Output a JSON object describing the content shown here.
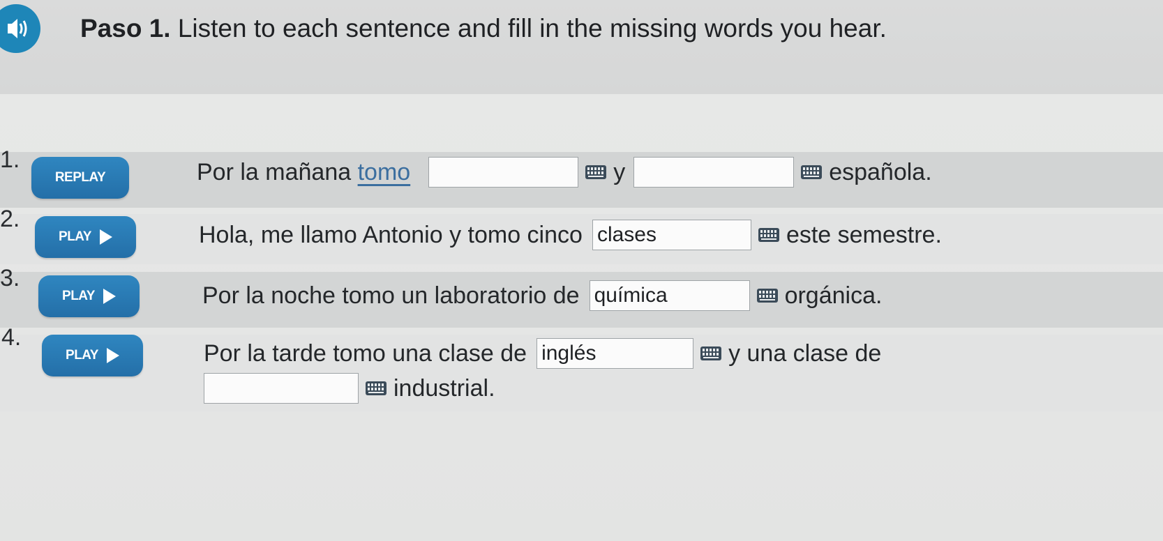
{
  "header": {
    "step_label": "Paso 1.",
    "instruction": "Listen to each sentence and fill in the missing words you hear."
  },
  "items": [
    {
      "number": "1.",
      "button_label": "REPLAY",
      "text_before": "Por la mañana",
      "answer_shown": "tomo",
      "input1_value": "",
      "connector": "y",
      "input2_value": "",
      "text_after": "española."
    },
    {
      "number": "2.",
      "button_label": "PLAY",
      "text_before": "Hola, me llamo Antonio y tomo cinco",
      "input1_value": "clases",
      "text_after": "este semestre."
    },
    {
      "number": "3.",
      "button_label": "PLAY",
      "text_before": "Por la noche tomo un laboratorio de",
      "input1_value": "química",
      "text_after": "orgánica."
    },
    {
      "number": "4.",
      "button_label": "PLAY",
      "text_before": "Por la tarde tomo una clase de",
      "input1_value": "inglés",
      "text_middle": "y una clase de",
      "input2_value": "",
      "text_after": "industrial."
    }
  ],
  "icons": {
    "audio": "speaker-icon",
    "keyboard": "keyboard-icon",
    "play": "play-triangle-icon"
  },
  "colors": {
    "button_blue": "#2878b2",
    "audio_blue": "#1e86b8"
  }
}
